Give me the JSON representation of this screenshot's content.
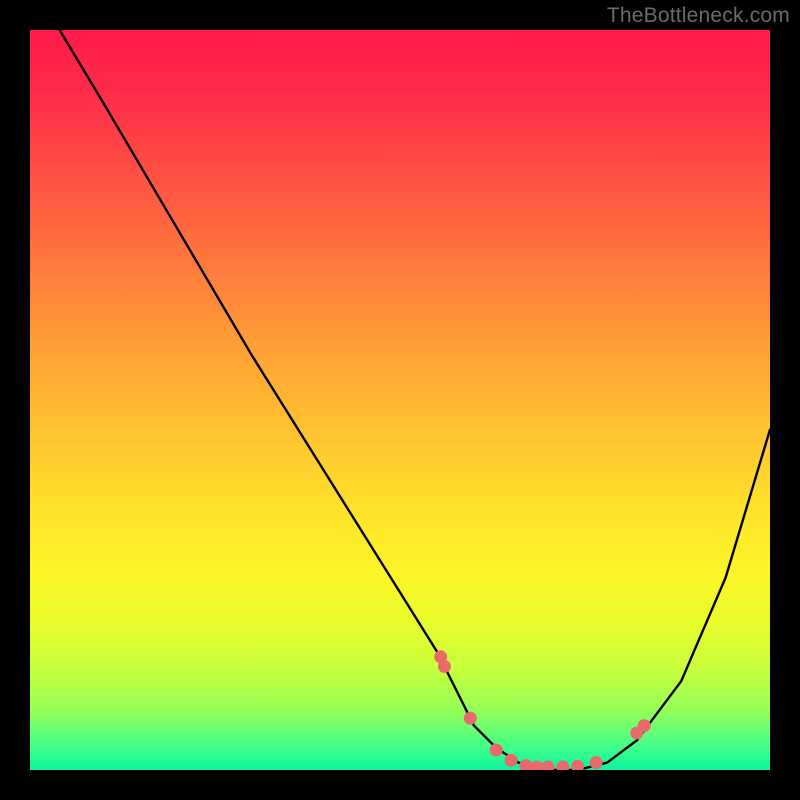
{
  "watermark": "TheBottleneck.com",
  "chart_data": {
    "type": "line",
    "title": "",
    "xlabel": "",
    "ylabel": "",
    "xlim": [
      0,
      100
    ],
    "ylim": [
      0,
      100
    ],
    "grid": false,
    "legend": false,
    "background_gradient": {
      "stops": [
        {
          "pos": 0.0,
          "color": "#ff1a4b"
        },
        {
          "pos": 0.5,
          "color": "#ffc82f"
        },
        {
          "pos": 0.8,
          "color": "#e9fc2b"
        },
        {
          "pos": 1.0,
          "color": "#0cf59e"
        }
      ]
    },
    "series": [
      {
        "name": "curve",
        "color": "#000000",
        "x": [
          4,
          10,
          20,
          30,
          40,
          50,
          55,
          58,
          60,
          63,
          66,
          70,
          74,
          78,
          82,
          88,
          94,
          100
        ],
        "values": [
          100,
          90,
          73,
          56,
          40,
          24,
          16,
          10,
          6,
          3,
          1,
          0,
          0,
          1,
          4,
          12,
          26,
          46
        ]
      },
      {
        "name": "markers",
        "type": "scatter",
        "color": "#e86a6a",
        "x": [
          55.5,
          56.0,
          59.5,
          63.0,
          65.0,
          67.0,
          68.5,
          70.0,
          72.0,
          74.0,
          76.5,
          82.0,
          83.0
        ],
        "values": [
          15.3,
          14.0,
          7.0,
          2.7,
          1.3,
          0.6,
          0.4,
          0.4,
          0.4,
          0.5,
          1.0,
          5.0,
          6.0
        ]
      }
    ]
  }
}
